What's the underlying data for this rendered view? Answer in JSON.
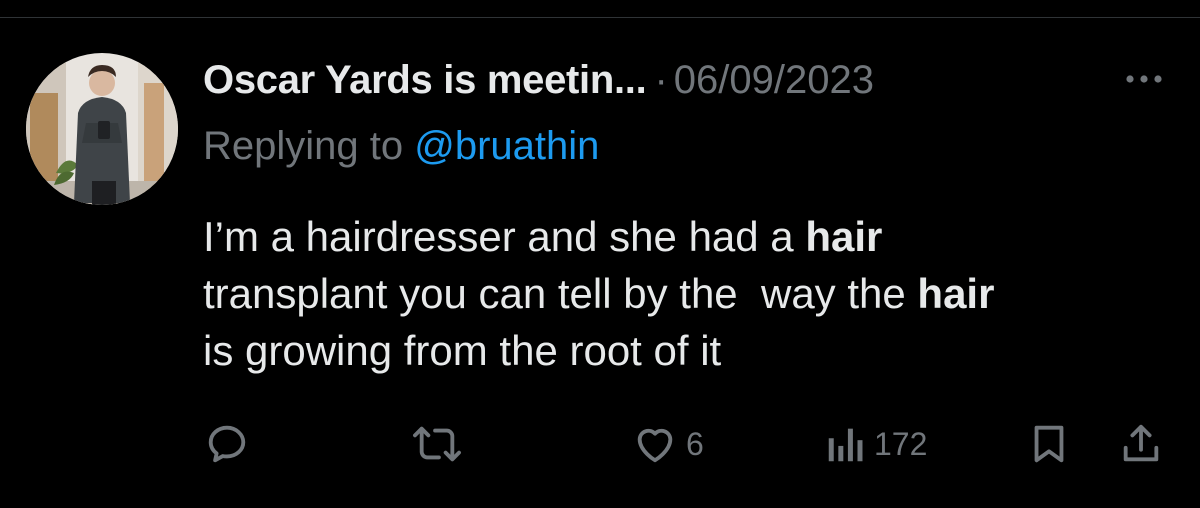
{
  "tweet": {
    "display_name": "Oscar Yards is meetin...",
    "separator": "·",
    "date": "06/09/2023",
    "reply_prefix": "Replying to",
    "reply_handle": "@bruathin",
    "text_segments": [
      {
        "text": "I’m a hairdresser and she had a ",
        "bold": false
      },
      {
        "text": "hair",
        "bold": true
      },
      {
        "text": "\ntransplant you can tell by the  way the ",
        "bold": false
      },
      {
        "text": "hair",
        "bold": true
      },
      {
        "text": "\nis growing from the root of it",
        "bold": false
      }
    ]
  },
  "actions": {
    "reply": {
      "icon": "reply-icon",
      "count": ""
    },
    "retweet": {
      "icon": "retweet-icon",
      "count": ""
    },
    "like": {
      "icon": "heart-icon",
      "count": "6"
    },
    "views": {
      "icon": "views-icon",
      "count": "172"
    },
    "bookmark": {
      "icon": "bookmark-icon"
    },
    "share": {
      "icon": "share-icon"
    }
  },
  "colors": {
    "background": "#000000",
    "text_primary": "#e7e9ea",
    "text_secondary": "#71767b",
    "accent": "#1d9bf0"
  }
}
